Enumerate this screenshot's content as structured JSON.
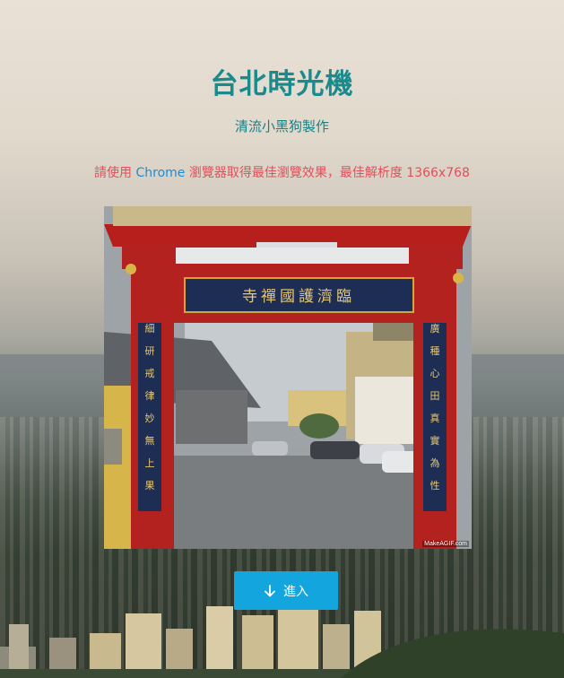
{
  "header": {
    "title": "台北時光機",
    "subtitle": "清流小黑狗製作"
  },
  "notice": {
    "before": "請使用 ",
    "browser": "Chrome",
    "after": " 瀏覽器取得最佳瀏覽效果，最佳解析度 1366x768"
  },
  "photo": {
    "credit": "MakeAGIF.com",
    "plaque": "臨濟護國禪寺",
    "left_couplet": "細研戒律妙無上果",
    "right_couplet": "廣種心田真實為性"
  },
  "enter_button": {
    "label": "進入",
    "icon": "arrow-down-icon"
  },
  "colors": {
    "title": "#1b8a8c",
    "notice": "#e74c5a",
    "browser_link": "#1f8bd6",
    "button": "#13a6de"
  }
}
